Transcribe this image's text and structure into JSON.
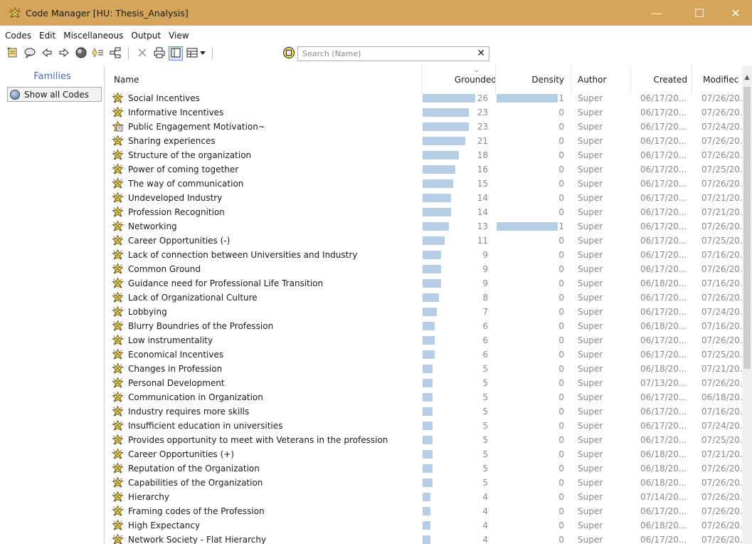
{
  "window": {
    "title": "Code Manager [HU: Thesis_Analysis]",
    "minimize_glyph": "—",
    "maximize_glyph": "☐",
    "close_glyph": "✕"
  },
  "menu": [
    "Codes",
    "Edit",
    "Miscellaneous",
    "Output",
    "View"
  ],
  "toolbar": {
    "icons": [
      "new-code-icon",
      "comment-icon",
      "back-arrow-icon",
      "forward-arrow-icon",
      "globe-icon",
      "filter-icon",
      "tree-icon",
      "delete-icon",
      "print-icon",
      "single-pane-icon",
      "table-view-icon",
      "dropdown-icon",
      "code-icon"
    ],
    "search_placeholder": "Search (Name)",
    "search_clear": "✕"
  },
  "families": {
    "header": "Families",
    "show_all": "Show all Codes"
  },
  "columns": {
    "name": "Name",
    "grounded": "Grounded",
    "density": "Density",
    "author": "Author",
    "created": "Created",
    "modified": "Modifiec"
  },
  "rows": [
    {
      "name": "Social Incentives",
      "grounded": 26,
      "density": 1,
      "author": "Super",
      "created": "06/17/20...",
      "modified": "07/26/20...",
      "icon": "code-icon"
    },
    {
      "name": "Informative Incentives",
      "grounded": 23,
      "density": 0,
      "author": "Super",
      "created": "06/17/20...",
      "modified": "07/26/20...",
      "icon": "code-icon"
    },
    {
      "name": "Public Engagement Motivation~",
      "grounded": 23,
      "density": 0,
      "author": "Super",
      "created": "06/17/20...",
      "modified": "07/24/20...",
      "icon": "commented-code-icon"
    },
    {
      "name": "Sharing experiences",
      "grounded": 21,
      "density": 0,
      "author": "Super",
      "created": "06/17/20...",
      "modified": "07/26/20...",
      "icon": "code-icon"
    },
    {
      "name": "Structure of the organization",
      "grounded": 18,
      "density": 0,
      "author": "Super",
      "created": "06/17/20...",
      "modified": "07/26/20...",
      "icon": "code-icon"
    },
    {
      "name": "Power of coming together",
      "grounded": 16,
      "density": 0,
      "author": "Super",
      "created": "06/17/20...",
      "modified": "07/25/20...",
      "icon": "code-icon"
    },
    {
      "name": "The way of communication",
      "grounded": 15,
      "density": 0,
      "author": "Super",
      "created": "06/17/20...",
      "modified": "07/26/20...",
      "icon": "code-icon"
    },
    {
      "name": "Undeveloped Industry",
      "grounded": 14,
      "density": 0,
      "author": "Super",
      "created": "06/17/20...",
      "modified": "07/21/20...",
      "icon": "code-icon"
    },
    {
      "name": "Profession Recognition",
      "grounded": 14,
      "density": 0,
      "author": "Super",
      "created": "06/17/20...",
      "modified": "07/21/20...",
      "icon": "code-icon"
    },
    {
      "name": "Networking",
      "grounded": 13,
      "density": 1,
      "author": "Super",
      "created": "06/17/20...",
      "modified": "07/26/20...",
      "icon": "code-icon"
    },
    {
      "name": "Career Opportunities (-)",
      "grounded": 11,
      "density": 0,
      "author": "Super",
      "created": "06/17/20...",
      "modified": "07/25/20...",
      "icon": "code-icon"
    },
    {
      "name": "Lack of connection between Universities and Industry",
      "grounded": 9,
      "density": 0,
      "author": "Super",
      "created": "06/17/20...",
      "modified": "07/16/20...",
      "icon": "code-icon"
    },
    {
      "name": "Common Ground",
      "grounded": 9,
      "density": 0,
      "author": "Super",
      "created": "06/17/20...",
      "modified": "07/26/20...",
      "icon": "code-icon"
    },
    {
      "name": "Guidance need for Professional Life Transition",
      "grounded": 9,
      "density": 0,
      "author": "Super",
      "created": "06/18/20...",
      "modified": "07/16/20...",
      "icon": "code-icon"
    },
    {
      "name": "Lack of Organizational Culture",
      "grounded": 8,
      "density": 0,
      "author": "Super",
      "created": "06/17/20...",
      "modified": "07/26/20...",
      "icon": "code-icon"
    },
    {
      "name": "Lobbying",
      "grounded": 7,
      "density": 0,
      "author": "Super",
      "created": "06/17/20...",
      "modified": "07/24/20...",
      "icon": "code-icon"
    },
    {
      "name": "Blurry Boundries of the Profession",
      "grounded": 6,
      "density": 0,
      "author": "Super",
      "created": "06/18/20...",
      "modified": "07/16/20...",
      "icon": "code-icon"
    },
    {
      "name": "Low instrumentality",
      "grounded": 6,
      "density": 0,
      "author": "Super",
      "created": "06/17/20...",
      "modified": "07/26/20...",
      "icon": "code-icon"
    },
    {
      "name": "Economical Incentives",
      "grounded": 6,
      "density": 0,
      "author": "Super",
      "created": "06/17/20...",
      "modified": "07/25/20...",
      "icon": "code-icon"
    },
    {
      "name": "Changes in Profession",
      "grounded": 5,
      "density": 0,
      "author": "Super",
      "created": "06/18/20...",
      "modified": "07/21/20...",
      "icon": "code-icon"
    },
    {
      "name": "Personal Development",
      "grounded": 5,
      "density": 0,
      "author": "Super",
      "created": "07/13/20...",
      "modified": "07/26/20...",
      "icon": "code-icon"
    },
    {
      "name": "Communication in Organization",
      "grounded": 5,
      "density": 0,
      "author": "Super",
      "created": "06/17/20...",
      "modified": "06/18/20...",
      "icon": "code-icon"
    },
    {
      "name": "Industry requires more skills",
      "grounded": 5,
      "density": 0,
      "author": "Super",
      "created": "06/17/20...",
      "modified": "07/16/20...",
      "icon": "code-icon"
    },
    {
      "name": "Insufficient education in universities",
      "grounded": 5,
      "density": 0,
      "author": "Super",
      "created": "06/17/20...",
      "modified": "07/24/20...",
      "icon": "code-icon"
    },
    {
      "name": "Provides opportunity to meet with Veterans in the profession",
      "grounded": 5,
      "density": 0,
      "author": "Super",
      "created": "06/17/20...",
      "modified": "07/25/20...",
      "icon": "code-icon"
    },
    {
      "name": "Career Opportunities (+)",
      "grounded": 5,
      "density": 0,
      "author": "Super",
      "created": "06/18/20...",
      "modified": "07/21/20...",
      "icon": "code-icon"
    },
    {
      "name": "Reputation of the Organization",
      "grounded": 5,
      "density": 0,
      "author": "Super",
      "created": "06/18/20...",
      "modified": "07/26/20...",
      "icon": "code-icon"
    },
    {
      "name": "Capabilities of the Organization",
      "grounded": 5,
      "density": 0,
      "author": "Super",
      "created": "06/18/20...",
      "modified": "07/26/20...",
      "icon": "code-icon"
    },
    {
      "name": "Hierarchy",
      "grounded": 4,
      "density": 0,
      "author": "Super",
      "created": "07/14/20...",
      "modified": "07/26/20...",
      "icon": "code-icon"
    },
    {
      "name": "Framing codes of the Profession",
      "grounded": 4,
      "density": 0,
      "author": "Super",
      "created": "06/17/20...",
      "modified": "07/26/20...",
      "icon": "code-icon"
    },
    {
      "name": "High Expectancy",
      "grounded": 4,
      "density": 0,
      "author": "Super",
      "created": "06/18/20...",
      "modified": "07/26/20...",
      "icon": "code-icon"
    },
    {
      "name": "Network Society - Flat Hierarchy",
      "grounded": 4,
      "density": 0,
      "author": "Super",
      "created": "06/17/20...",
      "modified": "07/26/20...",
      "icon": "code-icon"
    }
  ],
  "colors": {
    "titlebar": "#d4a55a",
    "bar_fill": "#b8cde6",
    "families_header": "#4a6fa5",
    "muted_text": "#8a8a8a"
  }
}
